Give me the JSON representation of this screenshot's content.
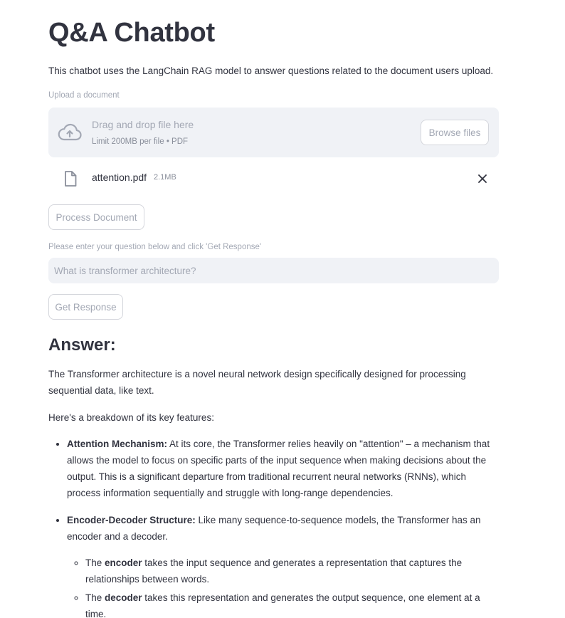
{
  "page": {
    "title": "Q&A Chatbot",
    "intro": "This chatbot uses the LangChain RAG model to answer questions related to the document users upload."
  },
  "uploader": {
    "label": "Upload a document",
    "drag_text": "Drag and drop file here",
    "limit_text": "Limit 200MB per file • PDF",
    "browse_label": "Browse files",
    "icon": "cloud-upload-icon"
  },
  "uploaded_file": {
    "name": "attention.pdf",
    "size": "2.1MB",
    "icon": "file-icon",
    "remove_icon": "close-icon"
  },
  "process_button": "Process Document",
  "question": {
    "label": "Please enter your question below and click 'Get Response'",
    "placeholder": "What is transformer architecture?",
    "value": ""
  },
  "response_button": "Get Response",
  "answer": {
    "heading": "Answer:",
    "paragraph_1": "The Transformer architecture is a novel neural network design specifically designed for processing sequential data, like text.",
    "paragraph_2": "Here's a breakdown of its key features:",
    "bullets": [
      {
        "term": "Attention Mechanism:",
        "text": " At its core, the Transformer relies heavily on \"attention\" – a mechanism that allows the model to focus on specific parts of the input sequence when making decisions about the output. This is a significant departure from traditional recurrent neural networks (RNNs), which process information sequentially and struggle with long-range dependencies."
      },
      {
        "term": "Encoder-Decoder Structure:",
        "text": " Like many sequence-to-sequence models, the Transformer has an encoder and a decoder.",
        "sub": [
          {
            "prefix": "The ",
            "term": "encoder",
            "text": " takes the input sequence and generates a representation that captures the relationships between words."
          },
          {
            "prefix": "The ",
            "term": "decoder",
            "text": " takes this representation and generates the output sequence, one element at a time."
          }
        ]
      }
    ]
  },
  "colors": {
    "text": "#31333f",
    "muted": "#a3a8b4",
    "field_bg": "#f0f2f6",
    "border": "#d4d6dc"
  }
}
